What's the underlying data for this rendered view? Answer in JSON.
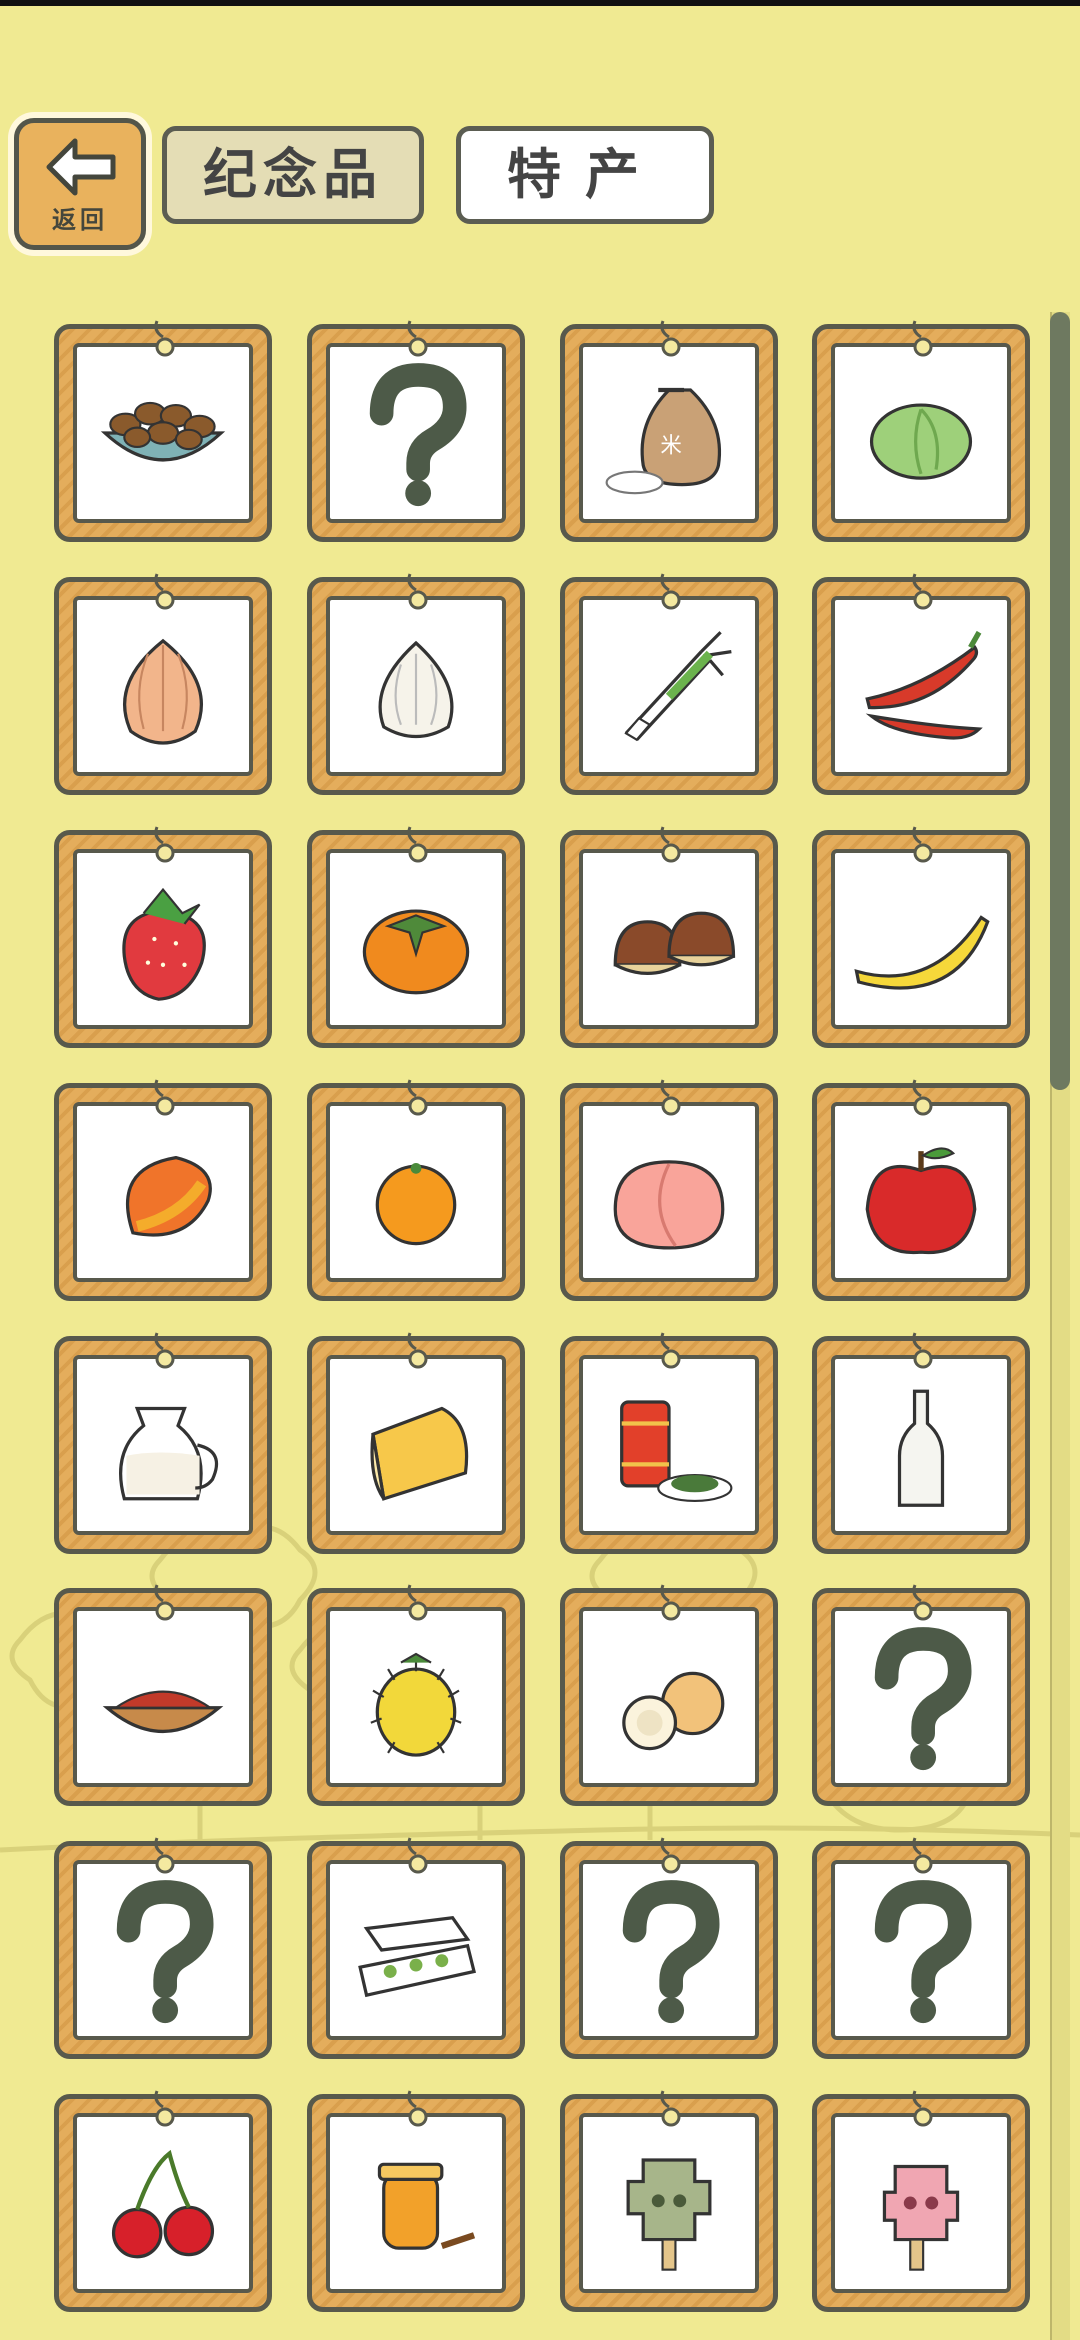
{
  "header": {
    "back_label": "返回",
    "tabs": [
      {
        "label": "纪念品",
        "selected": false
      },
      {
        "label": "特产",
        "selected": true
      }
    ]
  },
  "colors": {
    "background": "#f0ea92",
    "frame": "#e4ad5c",
    "border": "#58594c",
    "unknown_mark": "#4d5a48"
  },
  "items": [
    {
      "icon": "nuts-bowl-icon",
      "unlocked": true
    },
    {
      "icon": "question-mark-icon",
      "unlocked": false
    },
    {
      "icon": "rice-sack-icon",
      "unlocked": true
    },
    {
      "icon": "cabbage-icon",
      "unlocked": true
    },
    {
      "icon": "onion-icon",
      "unlocked": true
    },
    {
      "icon": "garlic-icon",
      "unlocked": true
    },
    {
      "icon": "green-onion-icon",
      "unlocked": true
    },
    {
      "icon": "chili-peppers-icon",
      "unlocked": true
    },
    {
      "icon": "strawberry-icon",
      "unlocked": true
    },
    {
      "icon": "persimmon-icon",
      "unlocked": true
    },
    {
      "icon": "chestnuts-icon",
      "unlocked": true
    },
    {
      "icon": "banana-icon",
      "unlocked": true
    },
    {
      "icon": "mango-icon",
      "unlocked": true
    },
    {
      "icon": "tangerine-icon",
      "unlocked": true
    },
    {
      "icon": "peach-icon",
      "unlocked": true
    },
    {
      "icon": "apple-icon",
      "unlocked": true
    },
    {
      "icon": "milk-jug-icon",
      "unlocked": true
    },
    {
      "icon": "cheese-icon",
      "unlocked": true
    },
    {
      "icon": "tea-can-icon",
      "unlocked": true
    },
    {
      "icon": "bottle-icon",
      "unlocked": true
    },
    {
      "icon": "goji-bowl-icon",
      "unlocked": true
    },
    {
      "icon": "horned-melon-icon",
      "unlocked": true
    },
    {
      "icon": "longan-icon",
      "unlocked": true
    },
    {
      "icon": "question-mark-icon",
      "unlocked": false
    },
    {
      "icon": "question-mark-icon",
      "unlocked": false
    },
    {
      "icon": "bento-box-icon",
      "unlocked": true
    },
    {
      "icon": "question-mark-icon",
      "unlocked": false
    },
    {
      "icon": "question-mark-icon",
      "unlocked": false
    },
    {
      "icon": "cherries-icon",
      "unlocked": true
    },
    {
      "icon": "honey-jar-icon",
      "unlocked": true
    },
    {
      "icon": "bronze-mask-popsicle-icon",
      "unlocked": true
    },
    {
      "icon": "pink-mask-popsicle-icon",
      "unlocked": true
    }
  ]
}
